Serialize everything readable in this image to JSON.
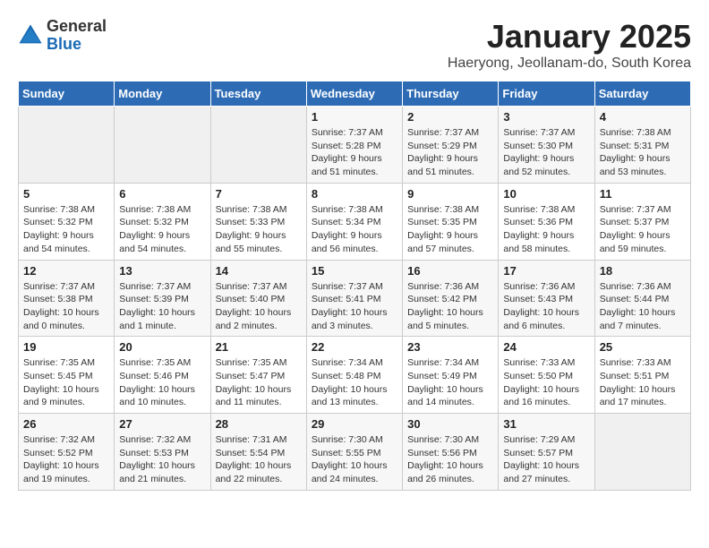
{
  "logo": {
    "general": "General",
    "blue": "Blue"
  },
  "title": "January 2025",
  "subtitle": "Haeryong, Jeollanam-do, South Korea",
  "days_of_week": [
    "Sunday",
    "Monday",
    "Tuesday",
    "Wednesday",
    "Thursday",
    "Friday",
    "Saturday"
  ],
  "weeks": [
    [
      {
        "day": "",
        "info": ""
      },
      {
        "day": "",
        "info": ""
      },
      {
        "day": "",
        "info": ""
      },
      {
        "day": "1",
        "info": "Sunrise: 7:37 AM\nSunset: 5:28 PM\nDaylight: 9 hours and 51 minutes."
      },
      {
        "day": "2",
        "info": "Sunrise: 7:37 AM\nSunset: 5:29 PM\nDaylight: 9 hours and 51 minutes."
      },
      {
        "day": "3",
        "info": "Sunrise: 7:37 AM\nSunset: 5:30 PM\nDaylight: 9 hours and 52 minutes."
      },
      {
        "day": "4",
        "info": "Sunrise: 7:38 AM\nSunset: 5:31 PM\nDaylight: 9 hours and 53 minutes."
      }
    ],
    [
      {
        "day": "5",
        "info": "Sunrise: 7:38 AM\nSunset: 5:32 PM\nDaylight: 9 hours and 54 minutes."
      },
      {
        "day": "6",
        "info": "Sunrise: 7:38 AM\nSunset: 5:32 PM\nDaylight: 9 hours and 54 minutes."
      },
      {
        "day": "7",
        "info": "Sunrise: 7:38 AM\nSunset: 5:33 PM\nDaylight: 9 hours and 55 minutes."
      },
      {
        "day": "8",
        "info": "Sunrise: 7:38 AM\nSunset: 5:34 PM\nDaylight: 9 hours and 56 minutes."
      },
      {
        "day": "9",
        "info": "Sunrise: 7:38 AM\nSunset: 5:35 PM\nDaylight: 9 hours and 57 minutes."
      },
      {
        "day": "10",
        "info": "Sunrise: 7:38 AM\nSunset: 5:36 PM\nDaylight: 9 hours and 58 minutes."
      },
      {
        "day": "11",
        "info": "Sunrise: 7:37 AM\nSunset: 5:37 PM\nDaylight: 9 hours and 59 minutes."
      }
    ],
    [
      {
        "day": "12",
        "info": "Sunrise: 7:37 AM\nSunset: 5:38 PM\nDaylight: 10 hours and 0 minutes."
      },
      {
        "day": "13",
        "info": "Sunrise: 7:37 AM\nSunset: 5:39 PM\nDaylight: 10 hours and 1 minute."
      },
      {
        "day": "14",
        "info": "Sunrise: 7:37 AM\nSunset: 5:40 PM\nDaylight: 10 hours and 2 minutes."
      },
      {
        "day": "15",
        "info": "Sunrise: 7:37 AM\nSunset: 5:41 PM\nDaylight: 10 hours and 3 minutes."
      },
      {
        "day": "16",
        "info": "Sunrise: 7:36 AM\nSunset: 5:42 PM\nDaylight: 10 hours and 5 minutes."
      },
      {
        "day": "17",
        "info": "Sunrise: 7:36 AM\nSunset: 5:43 PM\nDaylight: 10 hours and 6 minutes."
      },
      {
        "day": "18",
        "info": "Sunrise: 7:36 AM\nSunset: 5:44 PM\nDaylight: 10 hours and 7 minutes."
      }
    ],
    [
      {
        "day": "19",
        "info": "Sunrise: 7:35 AM\nSunset: 5:45 PM\nDaylight: 10 hours and 9 minutes."
      },
      {
        "day": "20",
        "info": "Sunrise: 7:35 AM\nSunset: 5:46 PM\nDaylight: 10 hours and 10 minutes."
      },
      {
        "day": "21",
        "info": "Sunrise: 7:35 AM\nSunset: 5:47 PM\nDaylight: 10 hours and 11 minutes."
      },
      {
        "day": "22",
        "info": "Sunrise: 7:34 AM\nSunset: 5:48 PM\nDaylight: 10 hours and 13 minutes."
      },
      {
        "day": "23",
        "info": "Sunrise: 7:34 AM\nSunset: 5:49 PM\nDaylight: 10 hours and 14 minutes."
      },
      {
        "day": "24",
        "info": "Sunrise: 7:33 AM\nSunset: 5:50 PM\nDaylight: 10 hours and 16 minutes."
      },
      {
        "day": "25",
        "info": "Sunrise: 7:33 AM\nSunset: 5:51 PM\nDaylight: 10 hours and 17 minutes."
      }
    ],
    [
      {
        "day": "26",
        "info": "Sunrise: 7:32 AM\nSunset: 5:52 PM\nDaylight: 10 hours and 19 minutes."
      },
      {
        "day": "27",
        "info": "Sunrise: 7:32 AM\nSunset: 5:53 PM\nDaylight: 10 hours and 21 minutes."
      },
      {
        "day": "28",
        "info": "Sunrise: 7:31 AM\nSunset: 5:54 PM\nDaylight: 10 hours and 22 minutes."
      },
      {
        "day": "29",
        "info": "Sunrise: 7:30 AM\nSunset: 5:55 PM\nDaylight: 10 hours and 24 minutes."
      },
      {
        "day": "30",
        "info": "Sunrise: 7:30 AM\nSunset: 5:56 PM\nDaylight: 10 hours and 26 minutes."
      },
      {
        "day": "31",
        "info": "Sunrise: 7:29 AM\nSunset: 5:57 PM\nDaylight: 10 hours and 27 minutes."
      },
      {
        "day": "",
        "info": ""
      }
    ]
  ]
}
